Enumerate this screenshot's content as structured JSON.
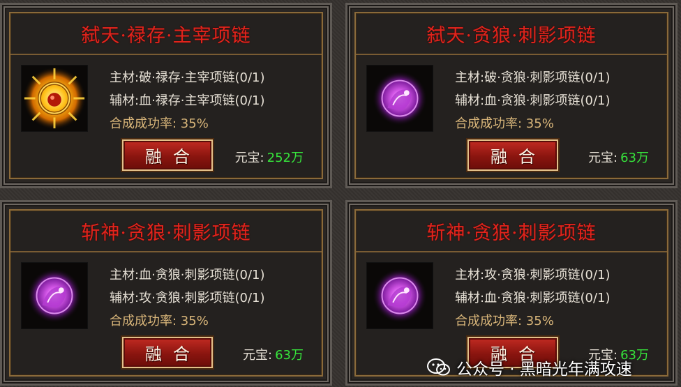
{
  "cards": [
    {
      "title": "弑天·禄存·主宰项链",
      "main_material": "主材:破·禄存·主宰项链(0/1)",
      "aux_material": "辅材:血·禄存·主宰项链(0/1)",
      "success_rate": "合成成功率:  35%",
      "fuse_label": "融合",
      "cost_label": "元宝:",
      "cost_value": "252万",
      "icon": "golden-sun-necklace-icon"
    },
    {
      "title": "弑天·贪狼·刺影项链",
      "main_material": "主材:破·贪狼·刺影项链(0/1)",
      "aux_material": "辅材:血·贪狼·刺影项链(0/1)",
      "success_rate": "合成成功率:  35%",
      "fuse_label": "融合",
      "cost_label": "元宝:",
      "cost_value": "63万",
      "icon": "purple-orb-necklace-icon"
    },
    {
      "title": "斩神·贪狼·刺影项链",
      "main_material": "主材:血·贪狼·刺影项链(0/1)",
      "aux_material": "辅材:攻·贪狼·刺影项链(0/1)",
      "success_rate": "合成成功率:  35%",
      "fuse_label": "融合",
      "cost_label": "元宝:",
      "cost_value": "63万",
      "icon": "purple-orb-necklace-icon"
    },
    {
      "title": "斩神·贪狼·刺影项链",
      "main_material": "主材:攻·贪狼·刺影项链(0/1)",
      "aux_material": "辅材:血·贪狼·刺影项链(0/1)",
      "success_rate": "合成成功率:  35%",
      "fuse_label": "融合",
      "cost_label": "元宝:",
      "cost_value": "63万",
      "icon": "purple-orb-necklace-icon"
    }
  ],
  "watermark": {
    "text": "公众号 · 黑暗光年满攻速",
    "icon": "wechat-icon"
  },
  "colors": {
    "title_red": "#e2241c",
    "cost_green": "#36e33b",
    "rate_gold": "#d9b67a",
    "button_red": "#8a150f"
  }
}
